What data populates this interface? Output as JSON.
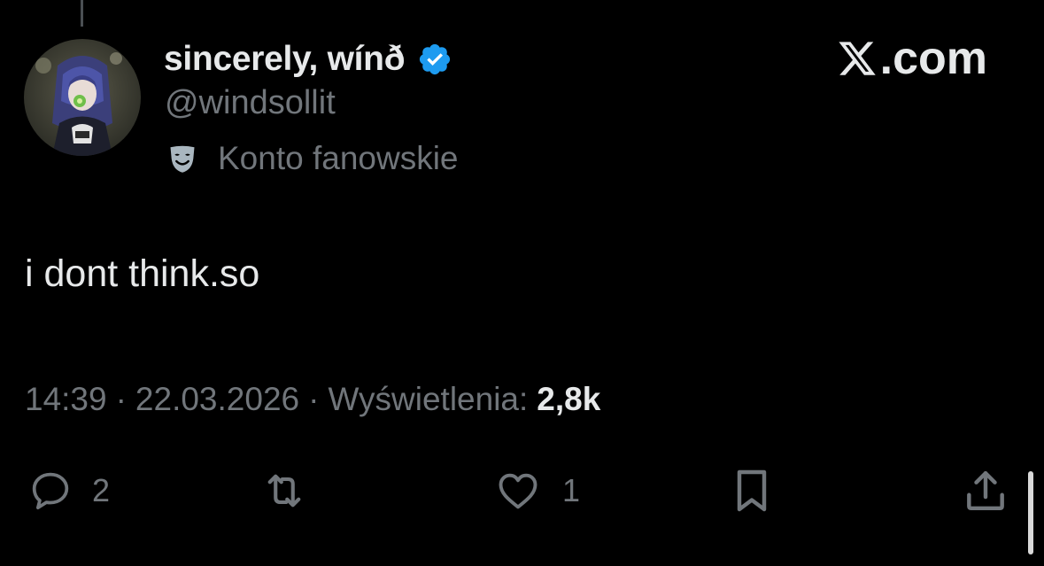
{
  "tweet": {
    "author": {
      "display_name": "sincerely, wínð",
      "handle": "@windsollit",
      "verified": true,
      "affiliation_label": "Konto fanowskie",
      "affiliation_icon": "theater-mask-icon",
      "avatar": "avatar-image"
    },
    "brand": {
      "logo_icon": "x-logo-icon",
      "suffix": ".com"
    },
    "text": "i dont think.so",
    "meta": {
      "time": "14:39",
      "date": "22.03.2026",
      "separator": "·",
      "views_label": "Wyświetlenia:",
      "views_count": "2,8k"
    },
    "actions": {
      "reply": {
        "icon": "reply-icon",
        "count": "2"
      },
      "repost": {
        "icon": "repost-icon"
      },
      "like": {
        "icon": "heart-icon",
        "count": "1"
      },
      "bookmark": {
        "icon": "bookmark-icon"
      },
      "share": {
        "icon": "share-icon"
      }
    }
  },
  "colors": {
    "background": "#000000",
    "primary_text": "#e7e9ea",
    "secondary_text": "#71767b",
    "verified_blue": "#1d9bf0"
  }
}
